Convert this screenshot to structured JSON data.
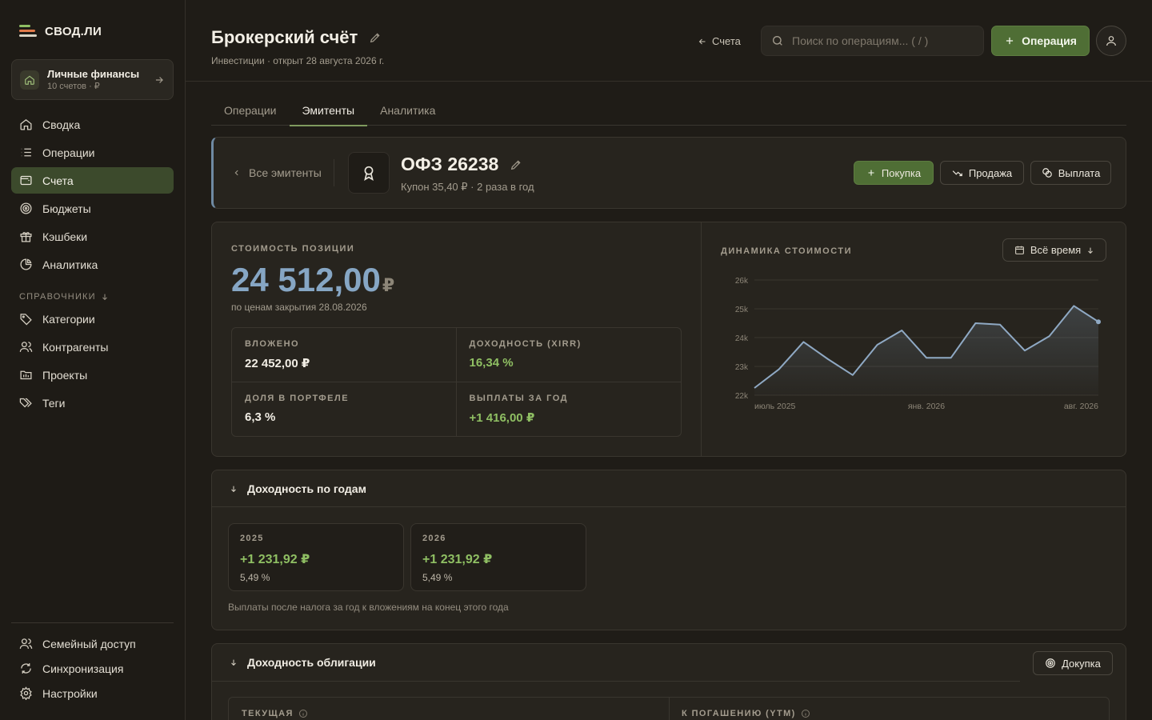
{
  "app": {
    "name": "СВОД.ЛИ"
  },
  "workspace": {
    "title": "Личные финансы",
    "subtitle": "10 счетов · ₽"
  },
  "nav": {
    "items": [
      {
        "label": "Сводка",
        "icon": "home-icon"
      },
      {
        "label": "Операции",
        "icon": "list-icon"
      },
      {
        "label": "Счета",
        "icon": "wallet-icon",
        "active": true
      },
      {
        "label": "Бюджеты",
        "icon": "target-icon"
      },
      {
        "label": "Кэшбеки",
        "icon": "gift-icon"
      },
      {
        "label": "Аналитика",
        "icon": "pie-chart-icon"
      }
    ],
    "section": "СПРАВОЧНИКИ",
    "ref_items": [
      {
        "label": "Категории",
        "icon": "tag-icon"
      },
      {
        "label": "Контрагенты",
        "icon": "users-icon"
      },
      {
        "label": "Проекты",
        "icon": "folder-icon"
      },
      {
        "label": "Теги",
        "icon": "tags-icon"
      }
    ],
    "bottom_items": [
      {
        "label": "Семейный доступ",
        "icon": "family-icon"
      },
      {
        "label": "Синхронизация",
        "icon": "sync-icon"
      },
      {
        "label": "Настройки",
        "icon": "gear-icon"
      }
    ]
  },
  "header": {
    "title": "Брокерский счёт",
    "subtitle": "Инвестиции · открыт 28 августа 2026 г.",
    "back_label": "Счета",
    "search_placeholder": "Поиск по операциям... ( / )",
    "primary_label": "Операция"
  },
  "tabs": [
    "Операции",
    "Эмитенты",
    "Аналитика"
  ],
  "issuer": {
    "back_label": "Все эмитенты",
    "name": "ОФЗ 26238",
    "subtitle": "Купон 35,40 ₽ · 2 раза в год",
    "buy_label": "Покупка",
    "sell_label": "Продажа",
    "payout_label": "Выплата"
  },
  "position": {
    "label": "СТОИМОСТЬ ПОЗИЦИИ",
    "value": "24 512,00",
    "currency": "₽",
    "date_note": "по ценам закрытия 28.08.2026",
    "metrics": [
      {
        "label": "ВЛОЖЕНО",
        "value": "22 452,00 ₽",
        "tone": "neutral"
      },
      {
        "label": "ДОХОДНОСТЬ (XIRR)",
        "value": "16,34 %",
        "tone": "green"
      },
      {
        "label": "ДОЛЯ В ПОРТФЕЛЕ",
        "value": "6,3 %",
        "tone": "neutral"
      },
      {
        "label": "ВЫПЛАТЫ ЗА ГОД",
        "value": "+1 416,00 ₽",
        "tone": "green"
      }
    ]
  },
  "dynamics": {
    "label": "ДИНАМИКА СТОИМОСТИ",
    "period_label": "Всё время"
  },
  "chart_data": {
    "type": "area",
    "y_ticks": [
      "26k",
      "25k",
      "24k",
      "23k",
      "22k"
    ],
    "ylim": [
      22000,
      26000
    ],
    "x_tick_labels": [
      "июль 2025",
      "янв. 2026",
      "авг. 2026"
    ],
    "values": [
      22250,
      22900,
      23850,
      23250,
      22700,
      23750,
      24250,
      23300,
      23300,
      24500,
      24450,
      23550,
      24050,
      25100,
      24550
    ],
    "color": "#8fa9c4"
  },
  "years": {
    "title": "Доходность по годам",
    "items": [
      {
        "year": "2025",
        "value": "+1 231,92 ₽",
        "pct": "5,49 %"
      },
      {
        "year": "2026",
        "value": "+1 231,92 ₽",
        "pct": "5,49 %"
      }
    ],
    "note": "Выплаты после налога за год к вложениям на конец этого года"
  },
  "bond_yield": {
    "title": "Доходность облигации",
    "action_label": "Докупка",
    "current_label": "ТЕКУЩАЯ",
    "ytm_label": "К ПОГАШЕНИЮ (YTM)"
  },
  "colors": {
    "accent": "#4f6e35",
    "active_nav": "#3c4a2c",
    "value_blue": "#86a6c4",
    "positive": "#8fbf63"
  }
}
